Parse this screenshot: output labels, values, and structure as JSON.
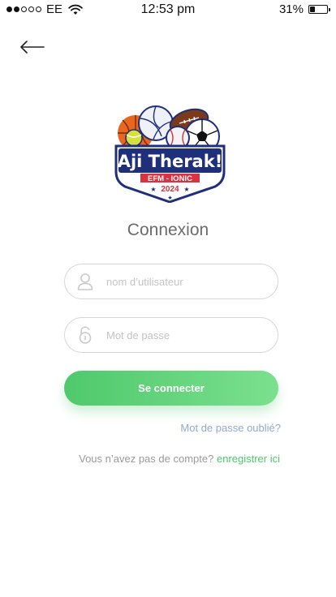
{
  "status_bar": {
    "carrier": "EE",
    "time": "12:53 pm",
    "battery": "31%",
    "battery_level": 0.31,
    "signal_bars_filled": 2,
    "signal_bars_total": 5
  },
  "logo": {
    "title": "Aji Therak!",
    "subtitle": "EFM - IONIC",
    "year": "2024"
  },
  "page": {
    "title": "Connexion"
  },
  "form": {
    "username_placeholder": "nom d’utilisateur",
    "password_placeholder": "Mot de passe",
    "submit_label": "Se connecter",
    "forgot_label": "Mot de passe oublié?",
    "register_prompt": "Vous n’avez pas de compte?",
    "register_link": "enregistrer ici"
  },
  "colors": {
    "accent_green": "#4fc96b",
    "link_blue": "#8fa9d6",
    "title_gray": "#6b6b6b",
    "logo_navy": "#1f2f7a",
    "logo_red": "#d8333f"
  }
}
